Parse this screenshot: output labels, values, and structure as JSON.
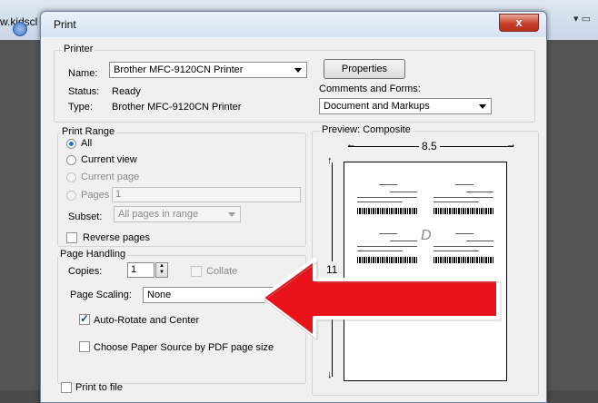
{
  "background": {
    "url_fragment": "w.kidscl"
  },
  "dialog": {
    "title": "Print",
    "close_label": "x",
    "printer": {
      "legend": "Printer",
      "name_label": "Name:",
      "name_value": "Brother MFC-9120CN Printer",
      "status_label": "Status:",
      "status_value": "Ready",
      "type_label": "Type:",
      "type_value": "Brother MFC-9120CN Printer",
      "properties_label": "Properties",
      "comments_label": "Comments and Forms:",
      "comments_value": "Document and Markups"
    },
    "print_range": {
      "legend": "Print Range",
      "all": "All",
      "current_view": "Current view",
      "current_page": "Current page",
      "pages": "Pages",
      "pages_value": "1",
      "subset_label": "Subset:",
      "subset_value": "All pages in range",
      "reverse_pages": "Reverse pages"
    },
    "page_handling": {
      "legend": "Page Handling",
      "copies_label": "Copies:",
      "copies_value": "1",
      "collate": "Collate",
      "scaling_label": "Page Scaling:",
      "scaling_value": "None",
      "auto_rotate": "Auto-Rotate and Center",
      "paper_source": "Choose Paper Source by PDF page size"
    },
    "print_to_file": "Print to file",
    "preview": {
      "legend": "Preview: Composite",
      "width_dim": "8.5",
      "height_dim": "11",
      "watermark": "D"
    }
  }
}
